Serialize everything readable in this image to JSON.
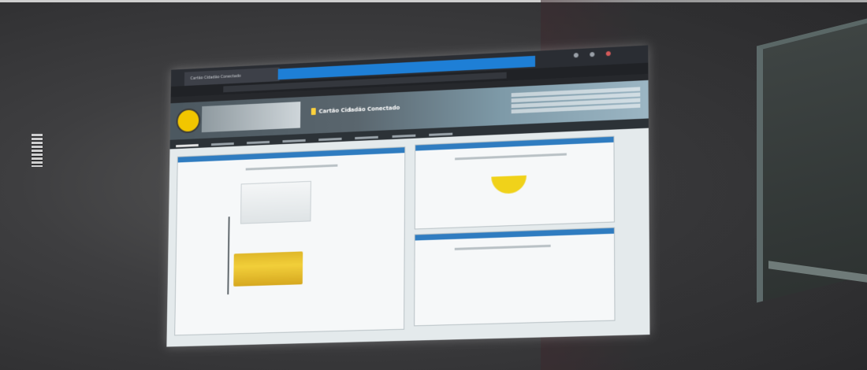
{
  "browser": {
    "tab_title": "Cartão Cidadão Conectado",
    "url": ""
  },
  "app": {
    "title": "Cartão Cidadão Conectado",
    "colors": {
      "header_gradient_start": "#4c5860",
      "header_gradient_end": "#9cb6c4",
      "panel_header": "#2f7cc0",
      "accent_yellow": "#f2cf3a",
      "logo_yellow": "#f2c600"
    }
  },
  "nav": {
    "item_count_hint": "blurred"
  },
  "icons": {
    "logo": "logo-icon",
    "title": "card-icon"
  }
}
